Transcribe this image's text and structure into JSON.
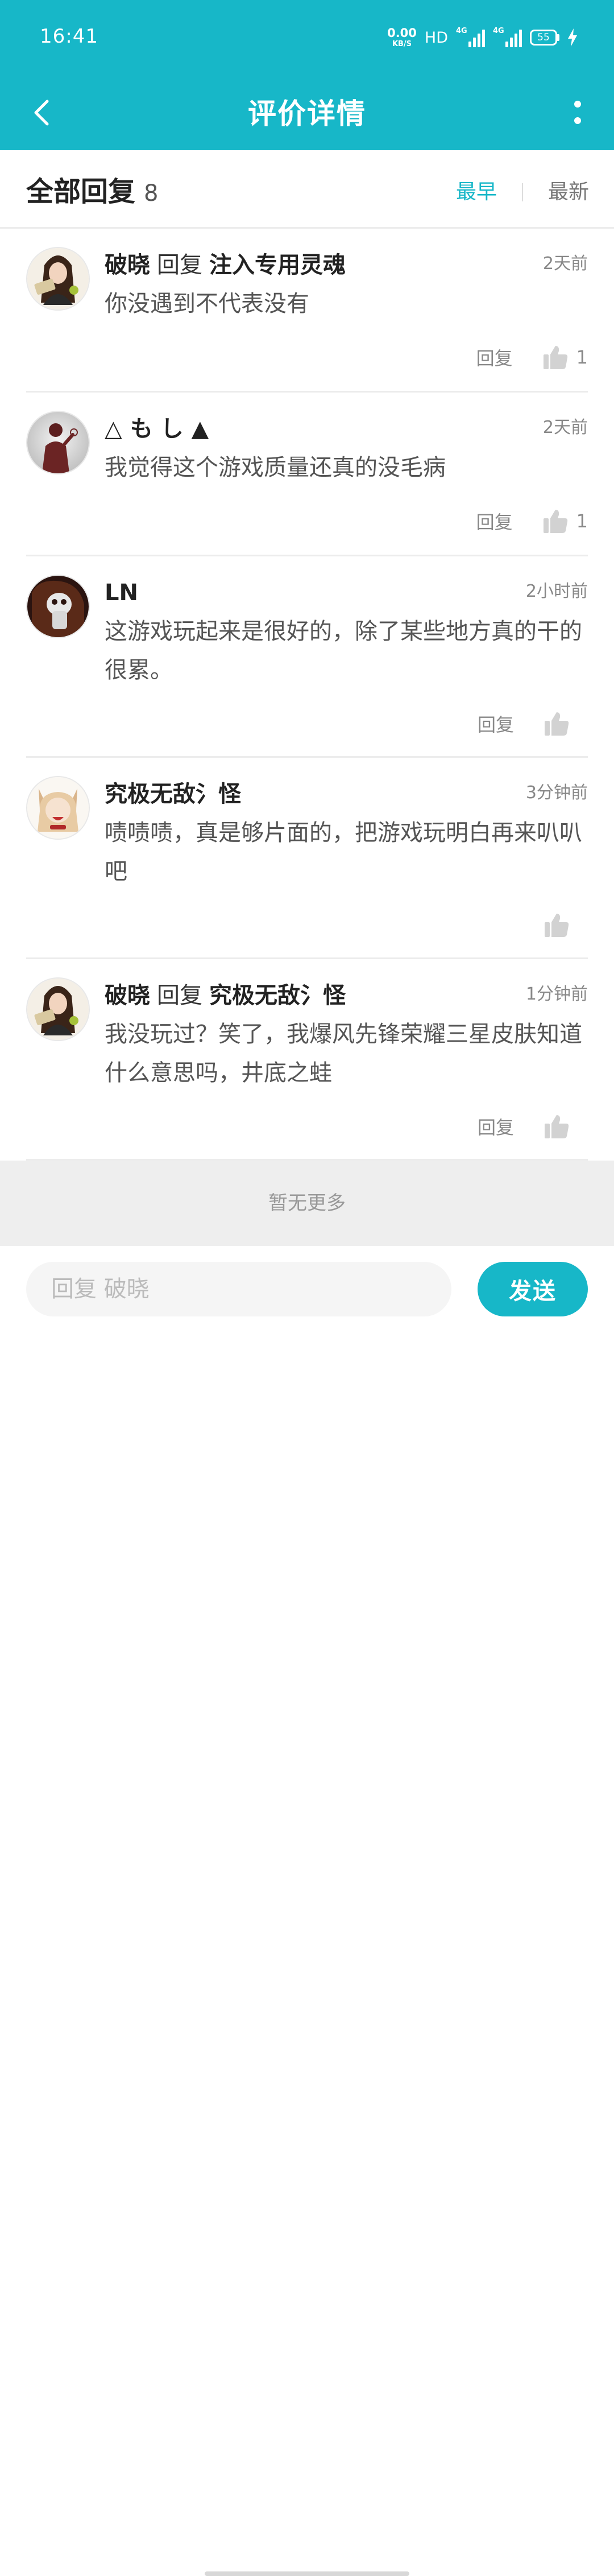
{
  "status_bar": {
    "time": "16:41",
    "net_speed_value": "0.00",
    "net_speed_unit": "KB/S",
    "hd_label": "HD",
    "sim1_label": "4G",
    "sim2_label": "4G",
    "battery": "55"
  },
  "header": {
    "title": "评价详情"
  },
  "replies": {
    "title": "全部回复",
    "count": "8",
    "sort_earliest": "最早",
    "sort_latest": "最新"
  },
  "comments": [
    {
      "author": "破晓",
      "reply_word": "回复",
      "reply_to": "注入专用灵魂",
      "time": "2天前",
      "text": "你没遇到不代表没有",
      "reply_label": "回复",
      "likes": "1",
      "avatar": "anime-girl-avatar"
    },
    {
      "author": "△ も し ▲",
      "reply_word": "",
      "reply_to": "",
      "time": "2天前",
      "text": "我觉得这个游戏质量还真的没毛病",
      "reply_label": "回复",
      "likes": "1",
      "avatar": "silhouette-avatar"
    },
    {
      "author": "LN",
      "reply_word": "",
      "reply_to": "",
      "time": "2小时前",
      "text": "这游戏玩起来是很好的，除了某些地方真的干的很累。",
      "reply_label": "回复",
      "likes": "",
      "avatar": "mask-avatar"
    },
    {
      "author": "究极无敌氵怪",
      "reply_word": "",
      "reply_to": "",
      "time": "3分钟前",
      "text": "啧啧啧，真是够片面的，把游戏玩明白再来叭叭吧",
      "reply_label": "",
      "likes": "",
      "avatar": "fox-girl-avatar"
    },
    {
      "author": "破晓",
      "reply_word": "回复",
      "reply_to": "究极无敌氵怪",
      "time": "1分钟前",
      "text": "我没玩过？笑了，我爆风先锋荣耀三星皮肤知道什么意思吗，井底之蛙",
      "reply_label": "回复",
      "likes": "",
      "avatar": "anime-girl-avatar"
    }
  ],
  "no_more": "暂无更多",
  "input": {
    "placeholder": "回复 破晓",
    "value": "",
    "send_label": "发送"
  },
  "colors": {
    "accent": "#17b7c8",
    "text_primary": "#222222",
    "text_secondary": "#888888",
    "divider": "#ececec"
  }
}
